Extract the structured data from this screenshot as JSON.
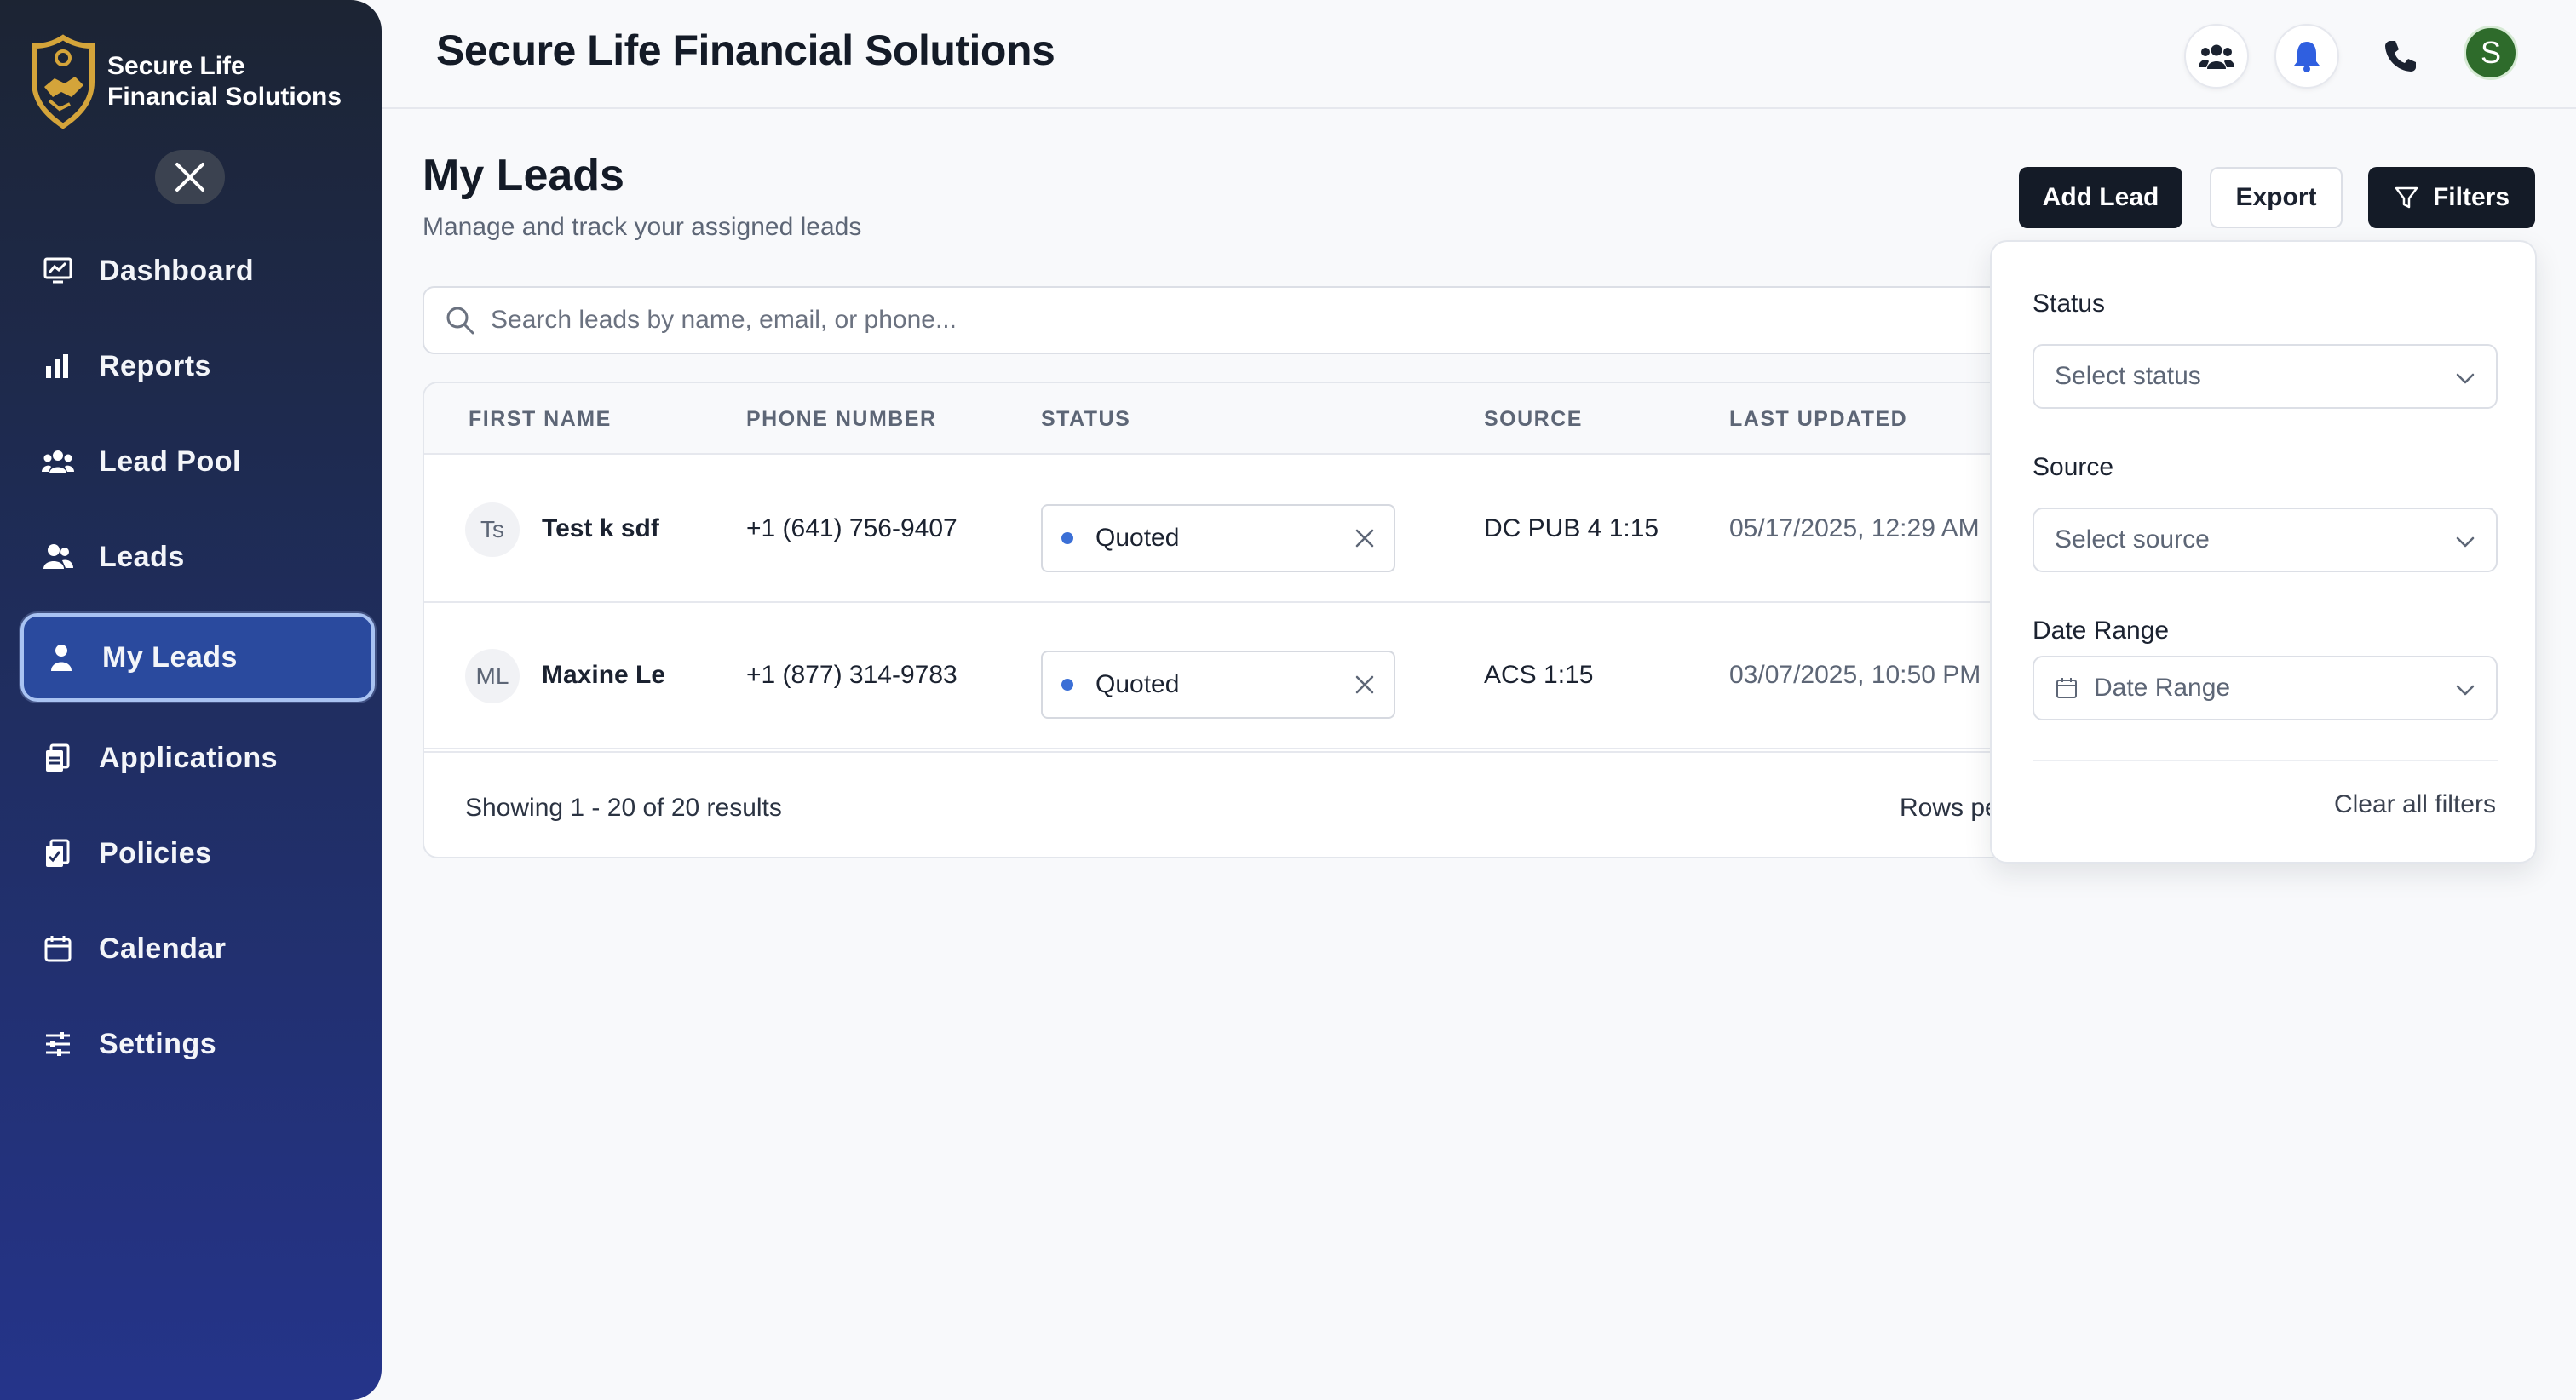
{
  "brand": {
    "name_line1": "Secure Life",
    "name_line2": "Financial Solutions"
  },
  "sidebar": {
    "items": [
      {
        "label": "Dashboard",
        "icon": "dashboard-icon"
      },
      {
        "label": "Reports",
        "icon": "bar-chart-icon"
      },
      {
        "label": "Lead Pool",
        "icon": "group-icon"
      },
      {
        "label": "Leads",
        "icon": "users-icon"
      },
      {
        "label": "My Leads",
        "icon": "user-icon",
        "active": true
      },
      {
        "label": "Applications",
        "icon": "applications-icon"
      },
      {
        "label": "Policies",
        "icon": "policies-icon"
      },
      {
        "label": "Calendar",
        "icon": "calendar-icon"
      },
      {
        "label": "Settings",
        "icon": "sliders-icon"
      }
    ]
  },
  "header": {
    "title": "Secure Life Financial Solutions",
    "avatar_initial": "S",
    "icons": [
      "team-icon",
      "bell-icon",
      "phone-icon"
    ]
  },
  "page": {
    "title": "My Leads",
    "subtitle": "Manage and track your assigned leads",
    "add_label": "Add Lead",
    "export_label": "Export",
    "filters_label": "Filters"
  },
  "search": {
    "placeholder": "Search leads by name, email, or phone..."
  },
  "table": {
    "columns": [
      "FIRST NAME",
      "PHONE NUMBER",
      "STATUS",
      "SOURCE",
      "LAST UPDATED"
    ],
    "rows": [
      {
        "initials": "Ts",
        "name": "Test k sdf",
        "phone": "+1 (641) 756-9407",
        "status": "Quoted",
        "source": "DC PUB 4 1:15",
        "updated": "05/17/2025, 12:29 AM"
      },
      {
        "initials": "ML",
        "name": "Maxine Le",
        "phone": "+1 (877) 314-9783",
        "status": "Quoted",
        "source": "ACS 1:15",
        "updated": "03/07/2025, 10:50 PM"
      }
    ],
    "showing": "Showing 1 - 20 of 20 results",
    "rows_per_page_label": "Rows pe"
  },
  "filters": {
    "status_label": "Status",
    "status_placeholder": "Select status",
    "source_label": "Source",
    "source_placeholder": "Select source",
    "date_label": "Date Range",
    "date_placeholder": "Date Range",
    "clear_label": "Clear all filters"
  },
  "colors": {
    "sidebar_top": "#1c2433",
    "sidebar_bottom": "#25348a",
    "active_item": "#2a4a9e",
    "dark_button": "#141b27",
    "status_dot": "#3b6fd6",
    "avatar_bg": "#2e6b2b",
    "bell": "#2f5fe0",
    "logo_gold": "#d4a43a"
  }
}
